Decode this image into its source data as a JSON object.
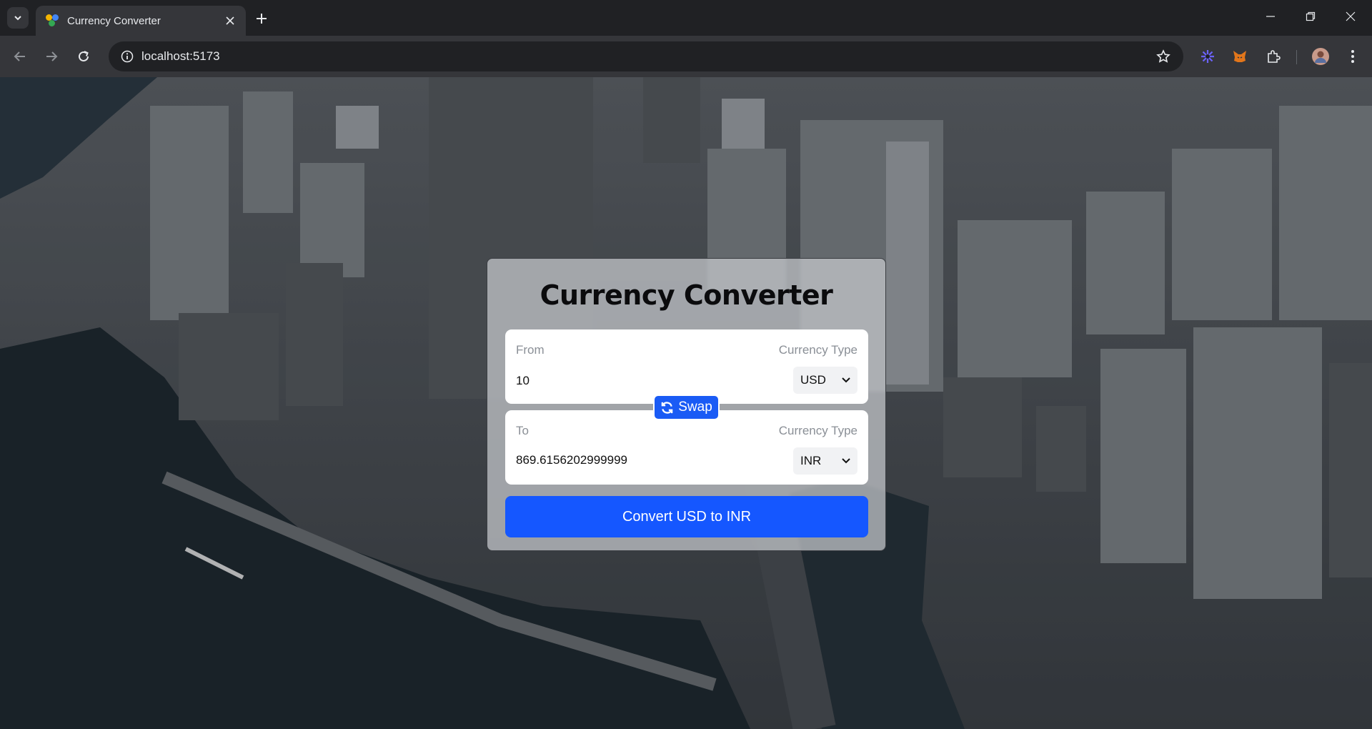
{
  "browser": {
    "tab_title": "Currency Converter",
    "url": "localhost:5173"
  },
  "app": {
    "title": "Currency Converter",
    "from": {
      "label": "From",
      "currency_type_label": "Currency Type",
      "amount": "10",
      "currency": "USD"
    },
    "to": {
      "label": "To",
      "currency_type_label": "Currency Type",
      "amount": "869.6156202999999",
      "currency": "INR"
    },
    "swap_label": "Swap",
    "convert_label": "Convert USD to INR"
  },
  "colors": {
    "primary_button": "#1557ff",
    "swap_button": "#1a5bf5",
    "card_overlay": "#c8cbcf"
  },
  "icons": {
    "swap": "refresh-icon",
    "select": "chevron-down-icon"
  }
}
